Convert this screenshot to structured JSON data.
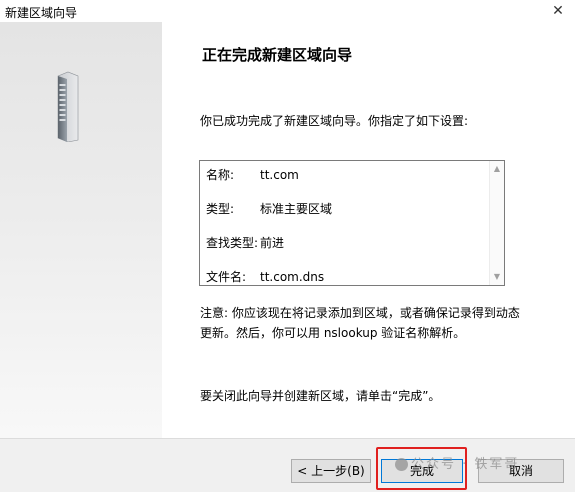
{
  "window": {
    "title": "新建区域向导",
    "close_glyph": "✕"
  },
  "side_panel": {
    "icon": "server-tower-icon"
  },
  "content": {
    "heading": "正在完成新建区域向导",
    "intro": "你已成功完成了新建区域向导。你指定了如下设置:",
    "summary": [
      {
        "key": "名称:",
        "value": "tt.com"
      },
      {
        "key": "类型:",
        "value": "标准主要区域"
      },
      {
        "key": "查找类型:",
        "value": "前进"
      },
      {
        "key": "文件名:",
        "value": "tt.com.dns"
      }
    ],
    "note": "注意: 你应该现在将记录添加到区域，或者确保记录得到动态更新。然后，你可以用 nslookup 验证名称解析。",
    "closing": "要关闭此向导并创建新区域，请单击“完成”。"
  },
  "buttons": {
    "back": "< 上一步(B)",
    "finish": "完成",
    "cancel": "取消"
  },
  "watermark": {
    "text": "公众号 · 铁军哥"
  },
  "colors": {
    "highlight": "#e0201f",
    "focus_border": "#0078d7"
  }
}
